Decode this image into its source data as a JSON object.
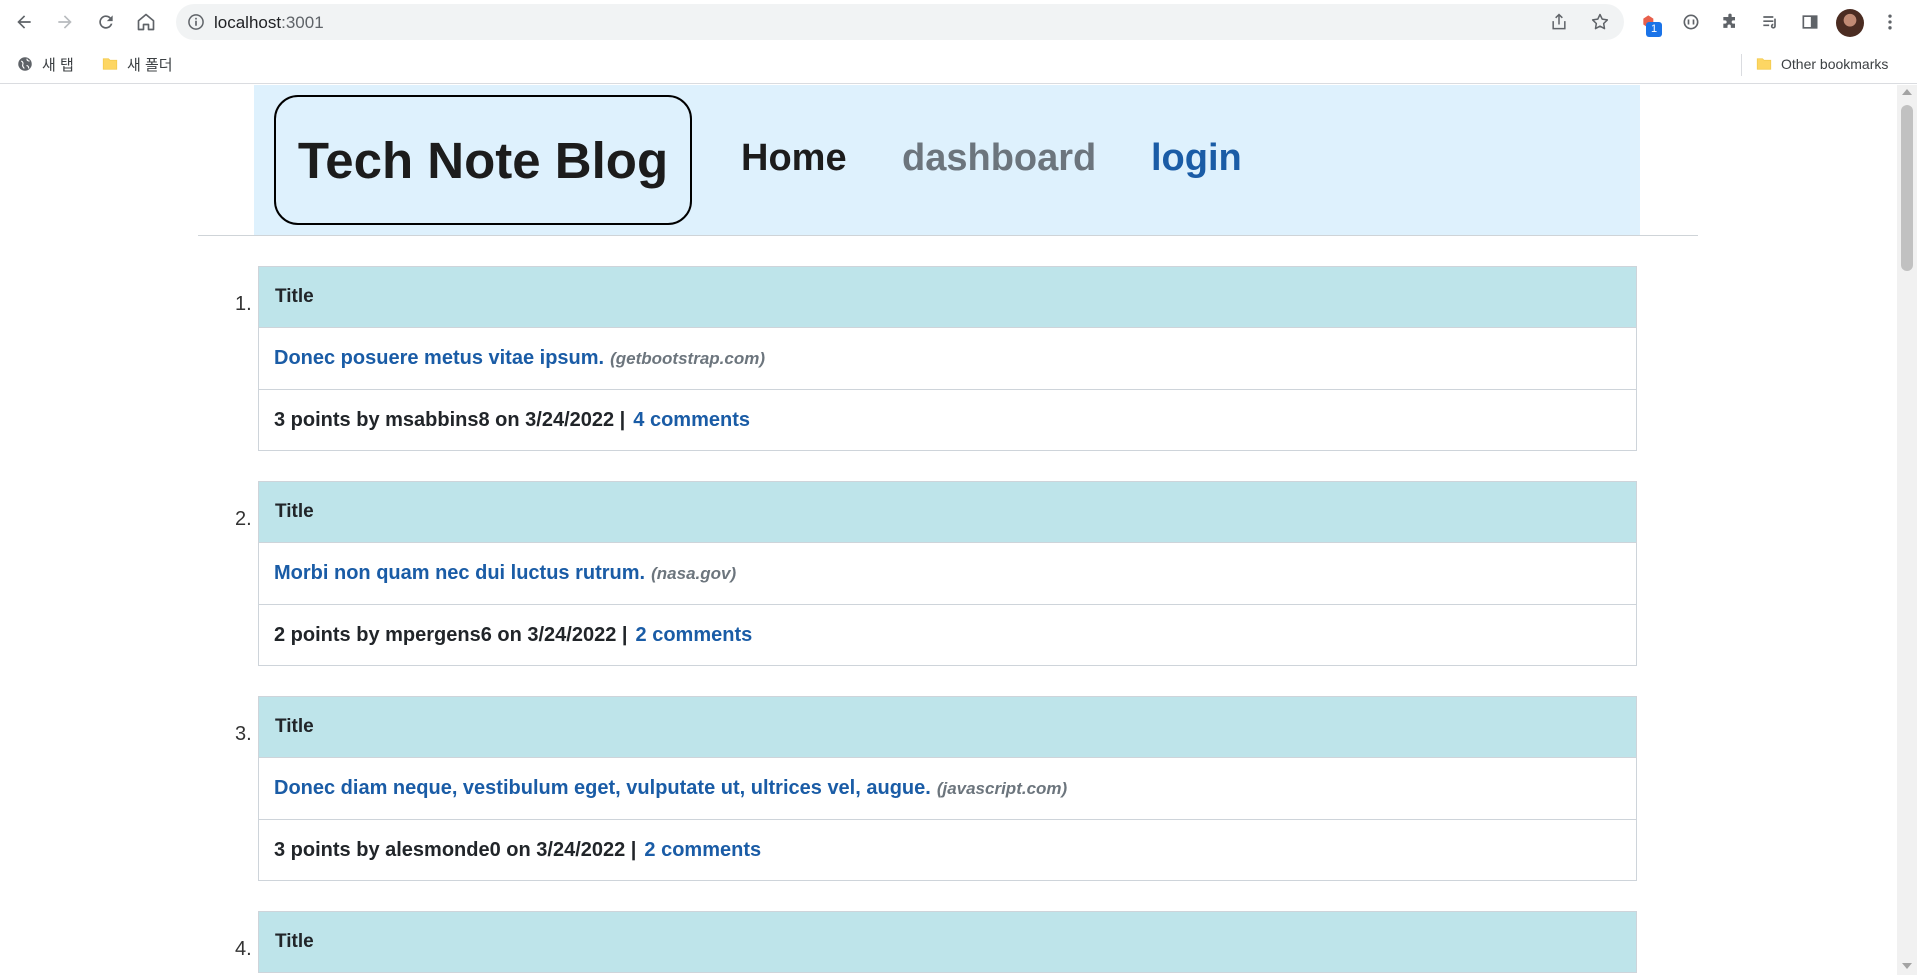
{
  "browser": {
    "url_host": "localhost",
    "url_port": ":3001",
    "bookmarks": [
      "새 탭",
      "새 폴더"
    ],
    "other_bookmarks": "Other bookmarks",
    "extension_badge": "1"
  },
  "header": {
    "logo": "Tech Note Blog",
    "nav": {
      "home": "Home",
      "dashboard": "dashboard",
      "login": "login"
    }
  },
  "posts": [
    {
      "number": "1.",
      "header": "Title",
      "title": "Donec posuere metus vitae ipsum.",
      "domain": "(getbootstrap.com)",
      "meta": "3 points by msabbins8 on 3/24/2022 |",
      "comments": "4 comments"
    },
    {
      "number": "2.",
      "header": "Title",
      "title": "Morbi non quam nec dui luctus rutrum.",
      "domain": "(nasa.gov)",
      "meta": "2 points by mpergens6 on 3/24/2022 |",
      "comments": "2 comments"
    },
    {
      "number": "3.",
      "header": "Title",
      "title": "Donec diam neque, vestibulum eget, vulputate ut, ultrices vel, augue.",
      "domain": "(javascript.com)",
      "meta": "3 points by alesmonde0 on 3/24/2022 |",
      "comments": "2 comments"
    },
    {
      "number": "4.",
      "header": "Title"
    }
  ],
  "colors": {
    "header_bg": "#def1fd",
    "card_header_bg": "#bee4ea",
    "link_blue": "#1a5ca6",
    "muted": "#6c757d"
  }
}
